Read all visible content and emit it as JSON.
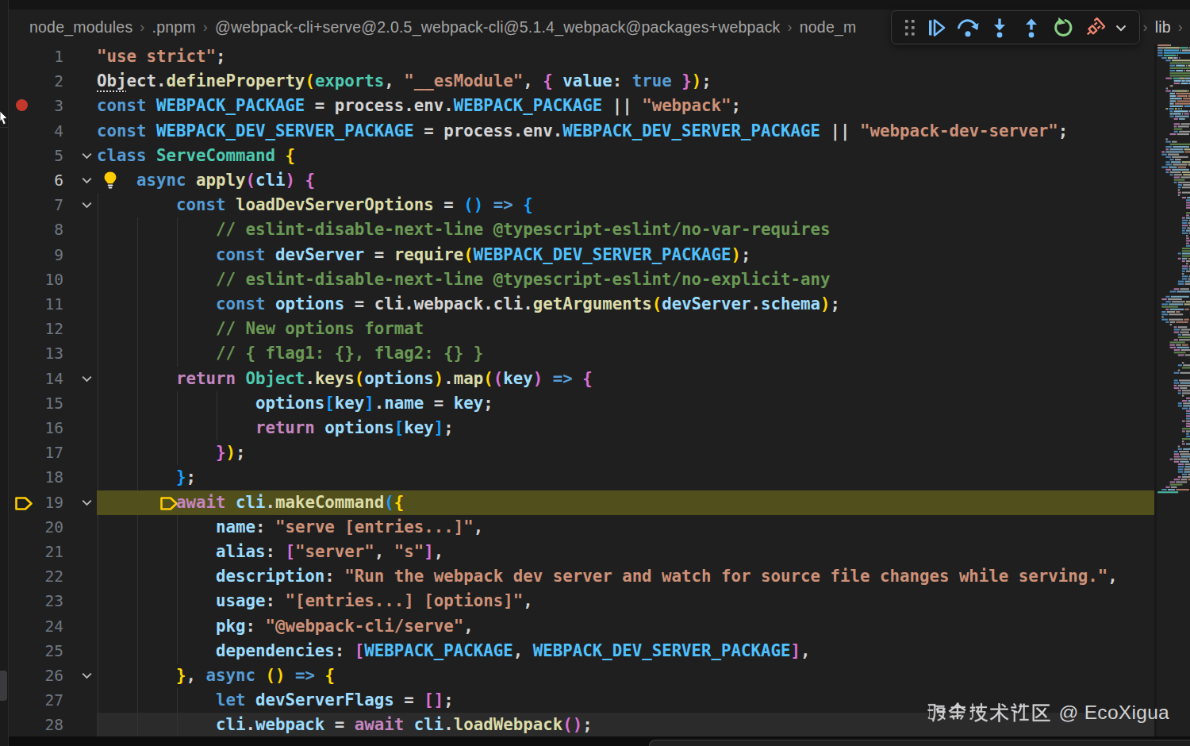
{
  "breadcrumb": {
    "separator": "›",
    "items": [
      {
        "label": "node_modules"
      },
      {
        "label": ".pnpm"
      },
      {
        "label": "@webpack-cli+serve@2.0.5_webpack-cli@5.1.4_webpack@packages+webpack"
      },
      {
        "label": "node_m"
      }
    ],
    "tail_items": [
      {
        "label": "lib"
      }
    ]
  },
  "debug_toolbar": {
    "buttons": [
      {
        "name": "drag-handle"
      },
      {
        "name": "continue"
      },
      {
        "name": "step-over"
      },
      {
        "name": "step-into"
      },
      {
        "name": "step-out"
      },
      {
        "name": "restart"
      },
      {
        "name": "disconnect"
      },
      {
        "name": "more-actions"
      }
    ]
  },
  "editor": {
    "breakpoint_line": 3,
    "debug_stopped_line": 19,
    "current_line": 28,
    "lightbulb_line": 6,
    "fold_lines": [
      5,
      6,
      7,
      14,
      19,
      26
    ],
    "palette": {
      "keyword": "#569cd6",
      "control": "#c586c0",
      "string": "#ce9178",
      "function": "#dcdcaa",
      "variable": "#9cdcfe",
      "constant": "#4fc1ff",
      "type": "#4ec9b0",
      "comment": "#6a9955",
      "punctuation": "#d4d4d4",
      "bracket1": "#ffd700",
      "bracket2": "#da70d6",
      "bracket3": "#179fff",
      "debug_line_bg": "#514f1b",
      "breakpoint": "#c4382c",
      "debug_arrow": "#ffcc00"
    },
    "lines": [
      {
        "n": 1,
        "guides": [],
        "tokens": [
          [
            "\"use strict\"",
            "str"
          ],
          [
            ";",
            "pn"
          ]
        ]
      },
      {
        "n": 2,
        "guides": [],
        "tokens": [
          [
            "Obj",
            "pn",
            "u"
          ],
          [
            "ect",
            "pn"
          ],
          [
            ".",
            "pn"
          ],
          [
            "defineProperty",
            "fn"
          ],
          [
            "(",
            "b1"
          ],
          [
            "exports",
            "ty"
          ],
          [
            ", ",
            "pn"
          ],
          [
            "\"__esModule\"",
            "str"
          ],
          [
            ", ",
            "pn"
          ],
          [
            "{ ",
            "b2x"
          ],
          [
            "value",
            "va"
          ],
          [
            ": ",
            "pn"
          ],
          [
            "true",
            "kw"
          ],
          [
            " ",
            "pn"
          ],
          [
            "}",
            "b2"
          ],
          [
            ")",
            "b1"
          ],
          [
            ";",
            "pn"
          ]
        ]
      },
      {
        "n": 3,
        "guides": [],
        "tokens": [
          [
            "const ",
            "kw"
          ],
          [
            "WEBPACK_PACKAGE",
            "co"
          ],
          [
            " = ",
            "pn"
          ],
          [
            "process.env.",
            "pn"
          ],
          [
            "WEBPACK_PACKAGE",
            "co"
          ],
          [
            " || ",
            "pn"
          ],
          [
            "\"webpack\"",
            "str"
          ],
          [
            ";",
            "pn"
          ]
        ]
      },
      {
        "n": 4,
        "guides": [],
        "tokens": [
          [
            "const ",
            "kw"
          ],
          [
            "WEBPACK_DEV_SERVER_PACKAGE",
            "co"
          ],
          [
            " = ",
            "pn"
          ],
          [
            "process.env.",
            "pn"
          ],
          [
            "WEBPACK_DEV_SERVER_PACKAGE",
            "co"
          ],
          [
            " || ",
            "pn"
          ],
          [
            "\"webpack-dev-server\"",
            "str"
          ],
          [
            ";",
            "pn"
          ]
        ]
      },
      {
        "n": 5,
        "guides": [],
        "tokens": [
          [
            "class ",
            "kw"
          ],
          [
            "ServeCommand",
            "ty"
          ],
          [
            " ",
            "pn"
          ],
          [
            "{",
            "b1"
          ]
        ]
      },
      {
        "n": 6,
        "guides": [],
        "indent": 4,
        "tokens": [
          [
            "async ",
            "kw"
          ],
          [
            "apply",
            "fn"
          ],
          [
            "(",
            "b2"
          ],
          [
            "cli",
            "va"
          ],
          [
            ")",
            "b2"
          ],
          [
            " ",
            "pn"
          ],
          [
            "{",
            "b2"
          ]
        ]
      },
      {
        "n": 7,
        "guides": [
          0
        ],
        "indent": 8,
        "tokens": [
          [
            "const ",
            "kw"
          ],
          [
            "loadDevServerOptions",
            "fn"
          ],
          [
            " = ",
            "pn"
          ],
          [
            "()",
            "b3"
          ],
          [
            " => ",
            "kw"
          ],
          [
            "{",
            "b3"
          ]
        ]
      },
      {
        "n": 8,
        "guides": [
          0,
          4,
          8
        ],
        "indent": 12,
        "tokens": [
          [
            "// eslint-disable-next-line @typescript-eslint/no-var-requires",
            "cm"
          ]
        ]
      },
      {
        "n": 9,
        "guides": [
          0,
          4,
          8
        ],
        "indent": 12,
        "tokens": [
          [
            "const ",
            "kw"
          ],
          [
            "devServer",
            "va"
          ],
          [
            " = ",
            "pn"
          ],
          [
            "require",
            "fn"
          ],
          [
            "(",
            "b1"
          ],
          [
            "WEBPACK_DEV_SERVER_PACKAGE",
            "co"
          ],
          [
            ")",
            "b1"
          ],
          [
            ";",
            "pn"
          ]
        ]
      },
      {
        "n": 10,
        "guides": [
          0,
          4,
          8
        ],
        "indent": 12,
        "tokens": [
          [
            "// eslint-disable-next-line @typescript-eslint/no-explicit-any",
            "cm"
          ]
        ]
      },
      {
        "n": 11,
        "guides": [
          0,
          4,
          8
        ],
        "indent": 12,
        "tokens": [
          [
            "const ",
            "kw"
          ],
          [
            "options",
            "va"
          ],
          [
            " = ",
            "pn"
          ],
          [
            "cli.webpack.cli.",
            "pn"
          ],
          [
            "getArguments",
            "fn"
          ],
          [
            "(",
            "b1"
          ],
          [
            "devServer",
            "va"
          ],
          [
            ".",
            "pn"
          ],
          [
            "schema",
            "va"
          ],
          [
            ")",
            "b1"
          ],
          [
            ";",
            "pn"
          ]
        ]
      },
      {
        "n": 12,
        "guides": [
          0,
          4,
          8
        ],
        "indent": 12,
        "tokens": [
          [
            "// New options format",
            "cm"
          ]
        ]
      },
      {
        "n": 13,
        "guides": [
          0,
          4,
          8
        ],
        "indent": 12,
        "tokens": [
          [
            "// { flag1: {}, flag2: {} }",
            "cm"
          ]
        ]
      },
      {
        "n": 14,
        "guides": [
          0,
          4
        ],
        "indent": 8,
        "tokens": [
          [
            "return ",
            "ctl"
          ],
          [
            "Object",
            "ty"
          ],
          [
            ".",
            "pn"
          ],
          [
            "keys",
            "fn"
          ],
          [
            "(",
            "b1"
          ],
          [
            "options",
            "va"
          ],
          [
            ")",
            "b1"
          ],
          [
            ".",
            "pn"
          ],
          [
            "map",
            "fn"
          ],
          [
            "(",
            "b1"
          ],
          [
            "(",
            "b2"
          ],
          [
            "key",
            "va"
          ],
          [
            ")",
            "b2"
          ],
          [
            " => ",
            "kw"
          ],
          [
            "{",
            "b2"
          ]
        ]
      },
      {
        "n": 15,
        "guides": [
          0,
          4,
          8,
          12
        ],
        "indent": 16,
        "tokens": [
          [
            "options",
            "va"
          ],
          [
            "[",
            "b3"
          ],
          [
            "key",
            "va"
          ],
          [
            "]",
            "b3"
          ],
          [
            ".",
            "pn"
          ],
          [
            "name",
            "va"
          ],
          [
            " = ",
            "pn"
          ],
          [
            "key",
            "va"
          ],
          [
            ";",
            "pn"
          ]
        ]
      },
      {
        "n": 16,
        "guides": [
          0,
          4,
          8,
          12
        ],
        "indent": 16,
        "tokens": [
          [
            "return ",
            "ctl"
          ],
          [
            "options",
            "va"
          ],
          [
            "[",
            "b3"
          ],
          [
            "key",
            "va"
          ],
          [
            "]",
            "b3"
          ],
          [
            ";",
            "pn"
          ]
        ]
      },
      {
        "n": 17,
        "guides": [
          0,
          4,
          8
        ],
        "indent": 12,
        "tokens": [
          [
            "}",
            "b2"
          ],
          [
            ")",
            "b1"
          ],
          [
            ";",
            "pn"
          ]
        ]
      },
      {
        "n": 18,
        "guides": [
          0,
          4
        ],
        "indent": 8,
        "tokens": [
          [
            "}",
            "b3"
          ],
          [
            ";",
            "pn"
          ]
        ]
      },
      {
        "n": 19,
        "guides": [],
        "indent": 8,
        "tokens": [
          [
            "await ",
            "ctl"
          ],
          [
            "cli",
            "va"
          ],
          [
            ".",
            "pn"
          ],
          [
            "makeCommand",
            "fn"
          ],
          [
            "(",
            "b3"
          ],
          [
            "{",
            "b1"
          ]
        ]
      },
      {
        "n": 20,
        "guides": [
          0,
          4,
          8
        ],
        "indent": 12,
        "tokens": [
          [
            "name",
            "va"
          ],
          [
            ": ",
            "pn"
          ],
          [
            "\"serve [entries...]\"",
            "str"
          ],
          [
            ",",
            "pn"
          ]
        ]
      },
      {
        "n": 21,
        "guides": [
          0,
          4,
          8
        ],
        "indent": 12,
        "tokens": [
          [
            "alias",
            "va"
          ],
          [
            ": ",
            "pn"
          ],
          [
            "[",
            "b2"
          ],
          [
            "\"server\"",
            "str"
          ],
          [
            ", ",
            "pn"
          ],
          [
            "\"s\"",
            "str"
          ],
          [
            "]",
            "b2"
          ],
          [
            ",",
            "pn"
          ]
        ]
      },
      {
        "n": 22,
        "guides": [
          0,
          4,
          8
        ],
        "indent": 12,
        "tokens": [
          [
            "description",
            "va"
          ],
          [
            ": ",
            "pn"
          ],
          [
            "\"Run the webpack dev server and watch for source file changes while serving.\"",
            "str"
          ],
          [
            ",",
            "pn"
          ]
        ]
      },
      {
        "n": 23,
        "guides": [
          0,
          4,
          8
        ],
        "indent": 12,
        "tokens": [
          [
            "usage",
            "va"
          ],
          [
            ": ",
            "pn"
          ],
          [
            "\"[entries...] [options]\"",
            "str"
          ],
          [
            ",",
            "pn"
          ]
        ]
      },
      {
        "n": 24,
        "guides": [
          0,
          4,
          8
        ],
        "indent": 12,
        "tokens": [
          [
            "pkg",
            "va"
          ],
          [
            ": ",
            "pn"
          ],
          [
            "\"@webpack-cli/serve\"",
            "str"
          ],
          [
            ",",
            "pn"
          ]
        ]
      },
      {
        "n": 25,
        "guides": [
          0,
          4,
          8
        ],
        "indent": 12,
        "tokens": [
          [
            "dependencies",
            "va"
          ],
          [
            ": ",
            "pn"
          ],
          [
            "[",
            "b2"
          ],
          [
            "WEBPACK_PACKAGE",
            "co"
          ],
          [
            ", ",
            "pn"
          ],
          [
            "WEBPACK_DEV_SERVER_PACKAGE",
            "co"
          ],
          [
            "]",
            "b2"
          ],
          [
            ",",
            "pn"
          ]
        ]
      },
      {
        "n": 26,
        "guides": [
          0,
          4
        ],
        "indent": 8,
        "tokens": [
          [
            "}",
            "b1"
          ],
          [
            ", ",
            "pn"
          ],
          [
            "async ",
            "kw"
          ],
          [
            "()",
            "b1"
          ],
          [
            " => ",
            "kw"
          ],
          [
            "{",
            "b1"
          ]
        ]
      },
      {
        "n": 27,
        "guides": [
          0,
          4,
          8
        ],
        "indent": 12,
        "tokens": [
          [
            "let ",
            "kw"
          ],
          [
            "devServerFlags",
            "va"
          ],
          [
            " = ",
            "pn"
          ],
          [
            "[]",
            "b2"
          ],
          [
            ";",
            "pn"
          ]
        ]
      },
      {
        "n": 28,
        "guides": [
          0,
          4,
          8
        ],
        "indent": 12,
        "tokens": [
          [
            "cli",
            "va"
          ],
          [
            ".",
            "pn"
          ],
          [
            "webpack",
            "va"
          ],
          [
            " = ",
            "pn"
          ],
          [
            "await ",
            "ctl"
          ],
          [
            "cli",
            "va"
          ],
          [
            ".",
            "pn"
          ],
          [
            "loadWebpack",
            "fn"
          ],
          [
            "()",
            "b2"
          ],
          [
            ";",
            "pn"
          ]
        ]
      }
    ]
  },
  "watermark": {
    "cjk_text": "掘金技术社区",
    "latin_text": " @ EcoXigua"
  }
}
